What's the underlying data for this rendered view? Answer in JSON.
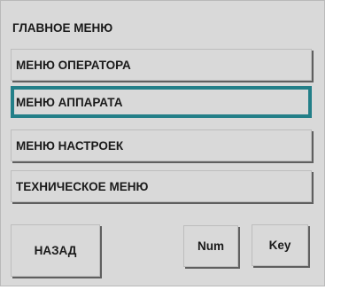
{
  "main_menu": {
    "title": "ГЛАВНОЕ МЕНЮ",
    "items": [
      {
        "label": "МЕНЮ ОПЕРАТОРА",
        "selected": false
      },
      {
        "label": "МЕНЮ АППАРАТА",
        "selected": true
      },
      {
        "label": "МЕНЮ НАСТРОЕК",
        "selected": false
      },
      {
        "label": "ТЕХНИЧЕСКОЕ МЕНЮ",
        "selected": false
      }
    ]
  },
  "footer": {
    "back_label": "НАЗАД",
    "num_label": "Num",
    "key_label": "Key"
  },
  "colors": {
    "panel": "#d9d9d9",
    "selection_border": "#237f88"
  }
}
